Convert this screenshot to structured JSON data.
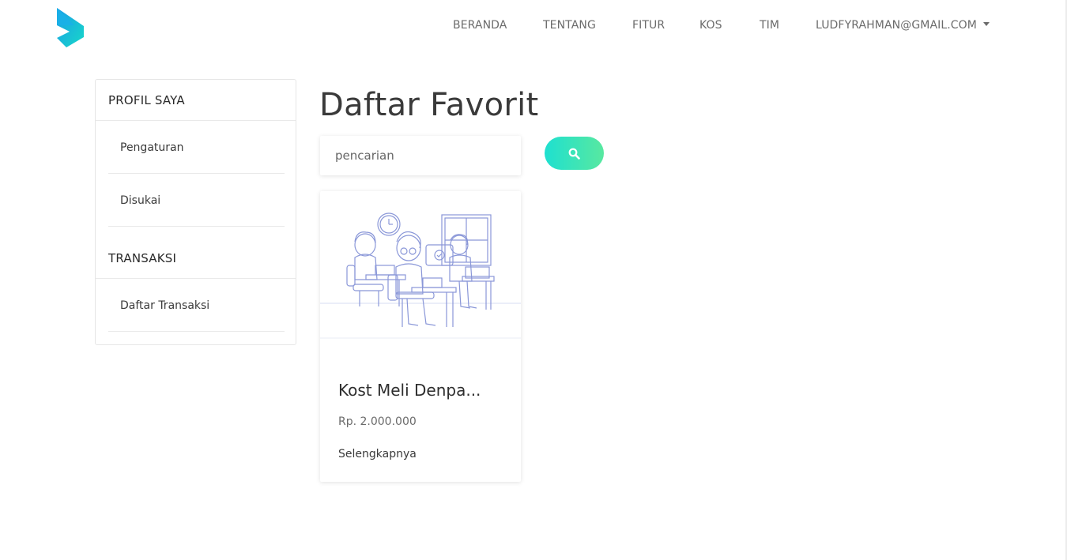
{
  "nav": {
    "items": [
      {
        "label": "BERANDA"
      },
      {
        "label": "TENTANG"
      },
      {
        "label": "FITUR"
      },
      {
        "label": "KOS"
      },
      {
        "label": "TIM"
      }
    ],
    "user": "LUDFYRAHMAN@GMAIL.COM"
  },
  "sidebar": {
    "sections": [
      {
        "title": "PROFIL SAYA",
        "items": [
          "Pengaturan",
          "Disukai"
        ]
      },
      {
        "title": "TRANSAKSI",
        "items": [
          "Daftar Transaksi"
        ]
      }
    ]
  },
  "main": {
    "title": "Daftar Favorit",
    "search_placeholder": "pencarian",
    "search_icon": "search-icon"
  },
  "cards": [
    {
      "title": "Kost Meli Denpa...",
      "price": "Rp. 2.000.000",
      "link": "Selengkapnya",
      "image": "people-working-illustration"
    }
  ],
  "colors": {
    "accent_start": "#1ee0d0",
    "accent_end": "#58e8a0",
    "logo": "#14c8d8"
  }
}
